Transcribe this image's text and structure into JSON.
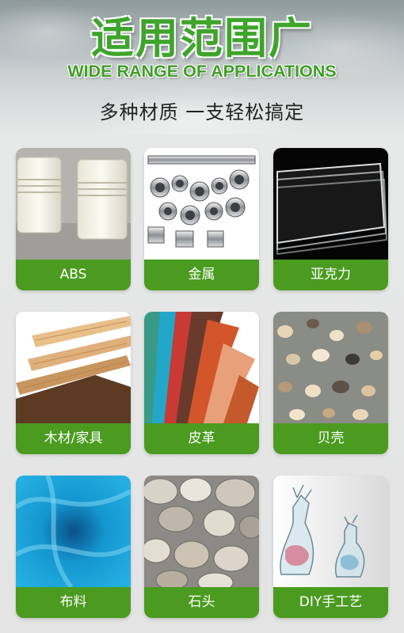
{
  "header": {
    "title": "适用范围广",
    "subtitle_en": "WIDE RANGE OF APPLICATIONS",
    "tagline": "多种材质  一支轻松搞定"
  },
  "colors": {
    "brand_green": "#3ea52b",
    "label_green": "#4a9b1f"
  },
  "materials": [
    {
      "label": "ABS"
    },
    {
      "label": "金属"
    },
    {
      "label": "亚克力"
    },
    {
      "label": "木材/家具"
    },
    {
      "label": "皮革"
    },
    {
      "label": "贝壳"
    },
    {
      "label": "布料"
    },
    {
      "label": "石头"
    },
    {
      "label": "DIY手工艺"
    }
  ]
}
